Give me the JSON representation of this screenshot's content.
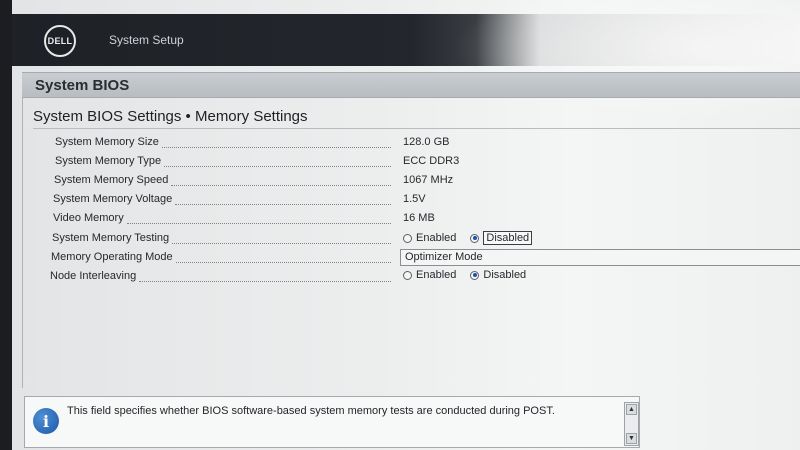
{
  "topbar": {
    "logo_text": "DELL",
    "title": "System Setup"
  },
  "header": {
    "title": "System BIOS"
  },
  "section": {
    "title": "System BIOS Settings • Memory Settings"
  },
  "settings": [
    {
      "label": "System Memory Size",
      "value": "128.0 GB"
    },
    {
      "label": "System Memory Type",
      "value": "ECC DDR3"
    },
    {
      "label": "System Memory Speed",
      "value": "1067 MHz"
    },
    {
      "label": "System Memory Voltage",
      "value": "1.5V"
    },
    {
      "label": "Video Memory",
      "value": "16 MB"
    },
    {
      "label": "System Memory Testing",
      "options": [
        "Enabled",
        "Disabled"
      ],
      "selected": "Disabled"
    },
    {
      "label": "Memory Operating Mode",
      "value": "Optimizer Mode"
    },
    {
      "label": "Node Interleaving",
      "options": [
        "Enabled",
        "Disabled"
      ],
      "selected": "Disabled"
    }
  ],
  "help": {
    "text": "This field specifies whether BIOS software-based system memory tests are conducted during POST.",
    "icon": "info-icon"
  },
  "colors": {
    "radio_selected": "#1f4fb0",
    "info_icon": "#1b58a6"
  }
}
